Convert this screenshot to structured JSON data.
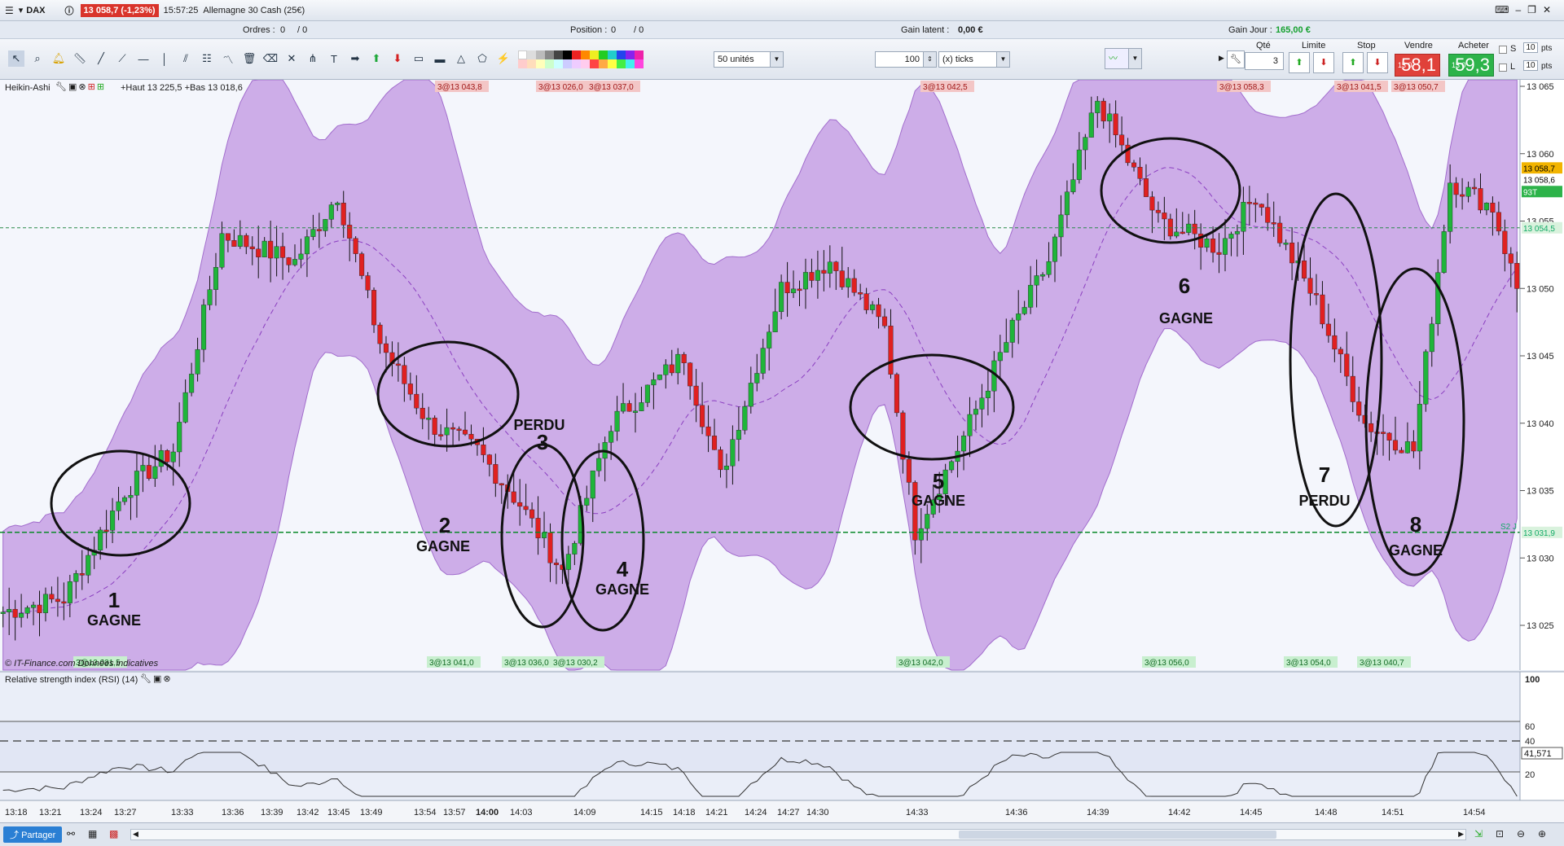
{
  "window": {
    "instrument": "DAX",
    "price_badge": "13 058,7 (-1,23%)",
    "time": "15:57:25",
    "name": "Allemagne 30 Cash (25€)"
  },
  "infobar": {
    "orders_label": "Ordres :",
    "orders_value": "0",
    "orders_sep": "/ 0",
    "position_label": "Position :",
    "position_value": "0",
    "position_sep": "/ 0",
    "latent_label": "Gain latent :",
    "latent_value": "0,00 €",
    "day_label": "Gain Jour :",
    "day_value": "165,00 €"
  },
  "toolbar": {
    "units_select": "50 unités",
    "ticks_value": "100",
    "ticks_select": "(x) ticks"
  },
  "order_panel": {
    "qty_label": "Qté",
    "qty_value": "3",
    "limit_label": "Limite",
    "stop_label": "Stop",
    "sell_label": "Vendre",
    "buy_label": "Acheter",
    "sell_small": "13 0",
    "sell_big": "58,1",
    "buy_small": "13 0",
    "buy_big": "59,3",
    "s_label": "S",
    "l_label": "L",
    "s_value": "10",
    "l_value": "10",
    "pts": "pts"
  },
  "chart": {
    "title": "Heikin-Ashi",
    "hilo": "+Haut 13 225,5 +Bas 13 018,6",
    "footer": "© IT-Finance.com Données indicatives",
    "price_axis": [
      "13 065",
      "13 060",
      "13 055",
      "13 050",
      "13 045",
      "13 040",
      "13 035",
      "13 030",
      "13 025"
    ],
    "price_markers": {
      "last": "13 058,7",
      "bid": "13 058,6",
      "tag": "93T",
      "level1": "13 054,5",
      "s2": "S2 J",
      "level2": "13 031,9"
    },
    "time_axis": [
      "13:18",
      "13:21",
      "13:24",
      "13:27",
      "13:33",
      "13:36",
      "13:39",
      "13:42",
      "13:45",
      "13:49",
      "13:54",
      "13:57",
      "14:00",
      "14:03",
      "14:09",
      "14:15",
      "14:18",
      "14:21",
      "14:24",
      "14:27",
      "14:30",
      "14:33",
      "14:36",
      "14:39",
      "14:42",
      "14:45",
      "14:48",
      "14:51",
      "14:54"
    ],
    "top_trades": [
      "3@13 043,8",
      "3@13 026,0",
      "3@13 037,0",
      "3@13 042,5",
      "3@13 058,3",
      "3@13 041,5",
      "3@13 050,7"
    ],
    "bottom_trades": [
      "3@13 031,5",
      "3@13 041,0",
      "3@13 036,0",
      "3@13 030,2",
      "3@13 042,0",
      "3@13 056,0",
      "3@13 054,0",
      "3@13 040,7"
    ],
    "annotations": [
      {
        "num": "1",
        "label": "GAGNE"
      },
      {
        "num": "2",
        "label": "GAGNE"
      },
      {
        "num": "3",
        "label": "PERDU"
      },
      {
        "num": "4",
        "label": "GAGNE"
      },
      {
        "num": "5",
        "label": "GAGNE"
      },
      {
        "num": "6",
        "label": "GAGNE"
      },
      {
        "num": "7",
        "label": "PERDU"
      },
      {
        "num": "8",
        "label": "GAGNE"
      }
    ]
  },
  "rsi": {
    "title": "Relative strength index (RSI) (14)",
    "axis": [
      "100",
      "60",
      "40",
      "20"
    ],
    "value": "41,571"
  },
  "statusbar": {
    "share": "Partager"
  },
  "colors": {
    "band": "#c9a6e6",
    "up": "#1fb53a",
    "down": "#e02020"
  }
}
